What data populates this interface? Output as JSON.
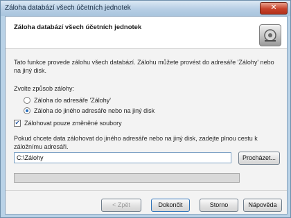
{
  "window": {
    "title": "Záloha databází všech účetních jednotek",
    "close_glyph": "✕"
  },
  "header": {
    "title": "Záloha databází všech účetních jednotek",
    "icon": "backup-icon"
  },
  "description": "Tato funkce provede zálohu všech databází. Zálohu můžete provést do adresáře 'Zálohy' nebo na jiný disk.",
  "mode": {
    "label": "Zvolte způsob zálohy:",
    "options": [
      {
        "label": "Záloha do adresáře 'Zálohy'",
        "selected": false
      },
      {
        "label": "Záloha do jiného adresáře nebo na jiný disk",
        "selected": true
      }
    ]
  },
  "changed_only": {
    "label": "Zálohovat pouze změněné soubory",
    "checked": true
  },
  "path": {
    "description": "Pokud chcete data zálohovat do jiného adresáře nebo na jiný disk, zadejte plnou cestu k záložnímu adresáři.",
    "value": "C:\\Zálohy",
    "browse_label": "Procházet..."
  },
  "progress": {
    "fraction": 0.0,
    "fill_color": "#4aa64a"
  },
  "buttons": {
    "back": "< Zpět",
    "finish": "Dokončit",
    "cancel": "Storno",
    "help": "Nápověda"
  }
}
